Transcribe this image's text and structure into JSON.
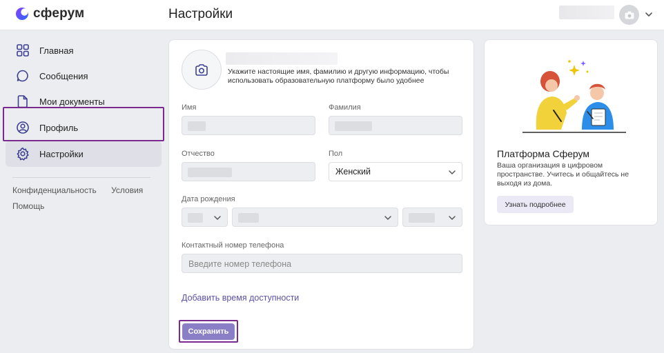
{
  "header": {
    "logo_text": "сферум",
    "page_title": "Настройки"
  },
  "sidebar": {
    "items": [
      {
        "label": "Главная",
        "icon": "grid-icon"
      },
      {
        "label": "Сообщения",
        "icon": "chat-bubble-icon"
      },
      {
        "label": "Мои документы",
        "icon": "document-icon"
      },
      {
        "label": "Профиль",
        "icon": "profile-icon"
      },
      {
        "label": "Настройки",
        "icon": "gear-icon",
        "active": true
      }
    ],
    "footer": {
      "privacy": "Конфиденциальность",
      "terms": "Условия",
      "help": "Помощь"
    }
  },
  "profile_form": {
    "photo_hint": "Укажите настоящие имя, фамилию и другую информацию, чтобы использовать образовательную платформу было удобнее",
    "first_name_label": "Имя",
    "last_name_label": "Фамилия",
    "patronymic_label": "Отчество",
    "gender_label": "Пол",
    "gender_value": "Женский",
    "birthdate_label": "Дата рождения",
    "phone_label": "Контактный номер телефона",
    "phone_placeholder": "Введите номер телефона",
    "availability_link": "Добавить время доступности",
    "save_button": "Сохранить"
  },
  "promo": {
    "title": "Платформа Сферум",
    "text": "Ваша организация в цифровом пространстве. Учитесь и общайтесь не выходя из дома.",
    "button": "Узнать подробнее"
  },
  "colors": {
    "accent": "#8a7ec7",
    "highlight_outline": "#7a2a8e",
    "link": "#5a52a8"
  }
}
